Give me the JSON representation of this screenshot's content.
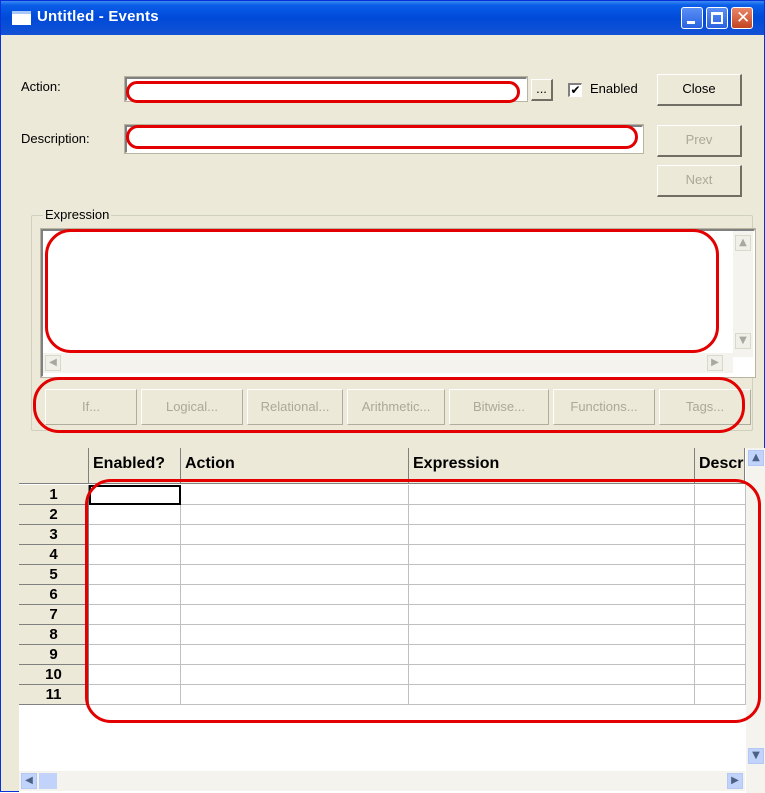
{
  "window": {
    "title": "Untitled - Events"
  },
  "form": {
    "action_label": "Action:",
    "action_value": "",
    "browse_label": "...",
    "enabled_label": "Enabled",
    "enabled_checked": true,
    "description_label": "Description:",
    "description_value": "",
    "expression_group": "Expression",
    "expression_value": ""
  },
  "buttons": {
    "close": "Close",
    "prev": "Prev",
    "next": "Next"
  },
  "operators": [
    "If...",
    "Logical...",
    "Relational...",
    "Arithmetic...",
    "Bitwise...",
    "Functions...",
    "Tags..."
  ],
  "grid": {
    "columns": [
      "Enabled?",
      "Action",
      "Expression",
      "Description"
    ],
    "rows": [
      "1",
      "2",
      "3",
      "4",
      "5",
      "6",
      "7",
      "8",
      "9",
      "10",
      "11"
    ]
  },
  "icons": {
    "check": "✔",
    "arrow_up": "▲",
    "arrow_down": "▼",
    "arrow_left": "◀",
    "arrow_right": "▶"
  },
  "colors": {
    "annotation": "#e20000",
    "titlebar": "#0049d8",
    "window_bg": "#ece9d8"
  }
}
